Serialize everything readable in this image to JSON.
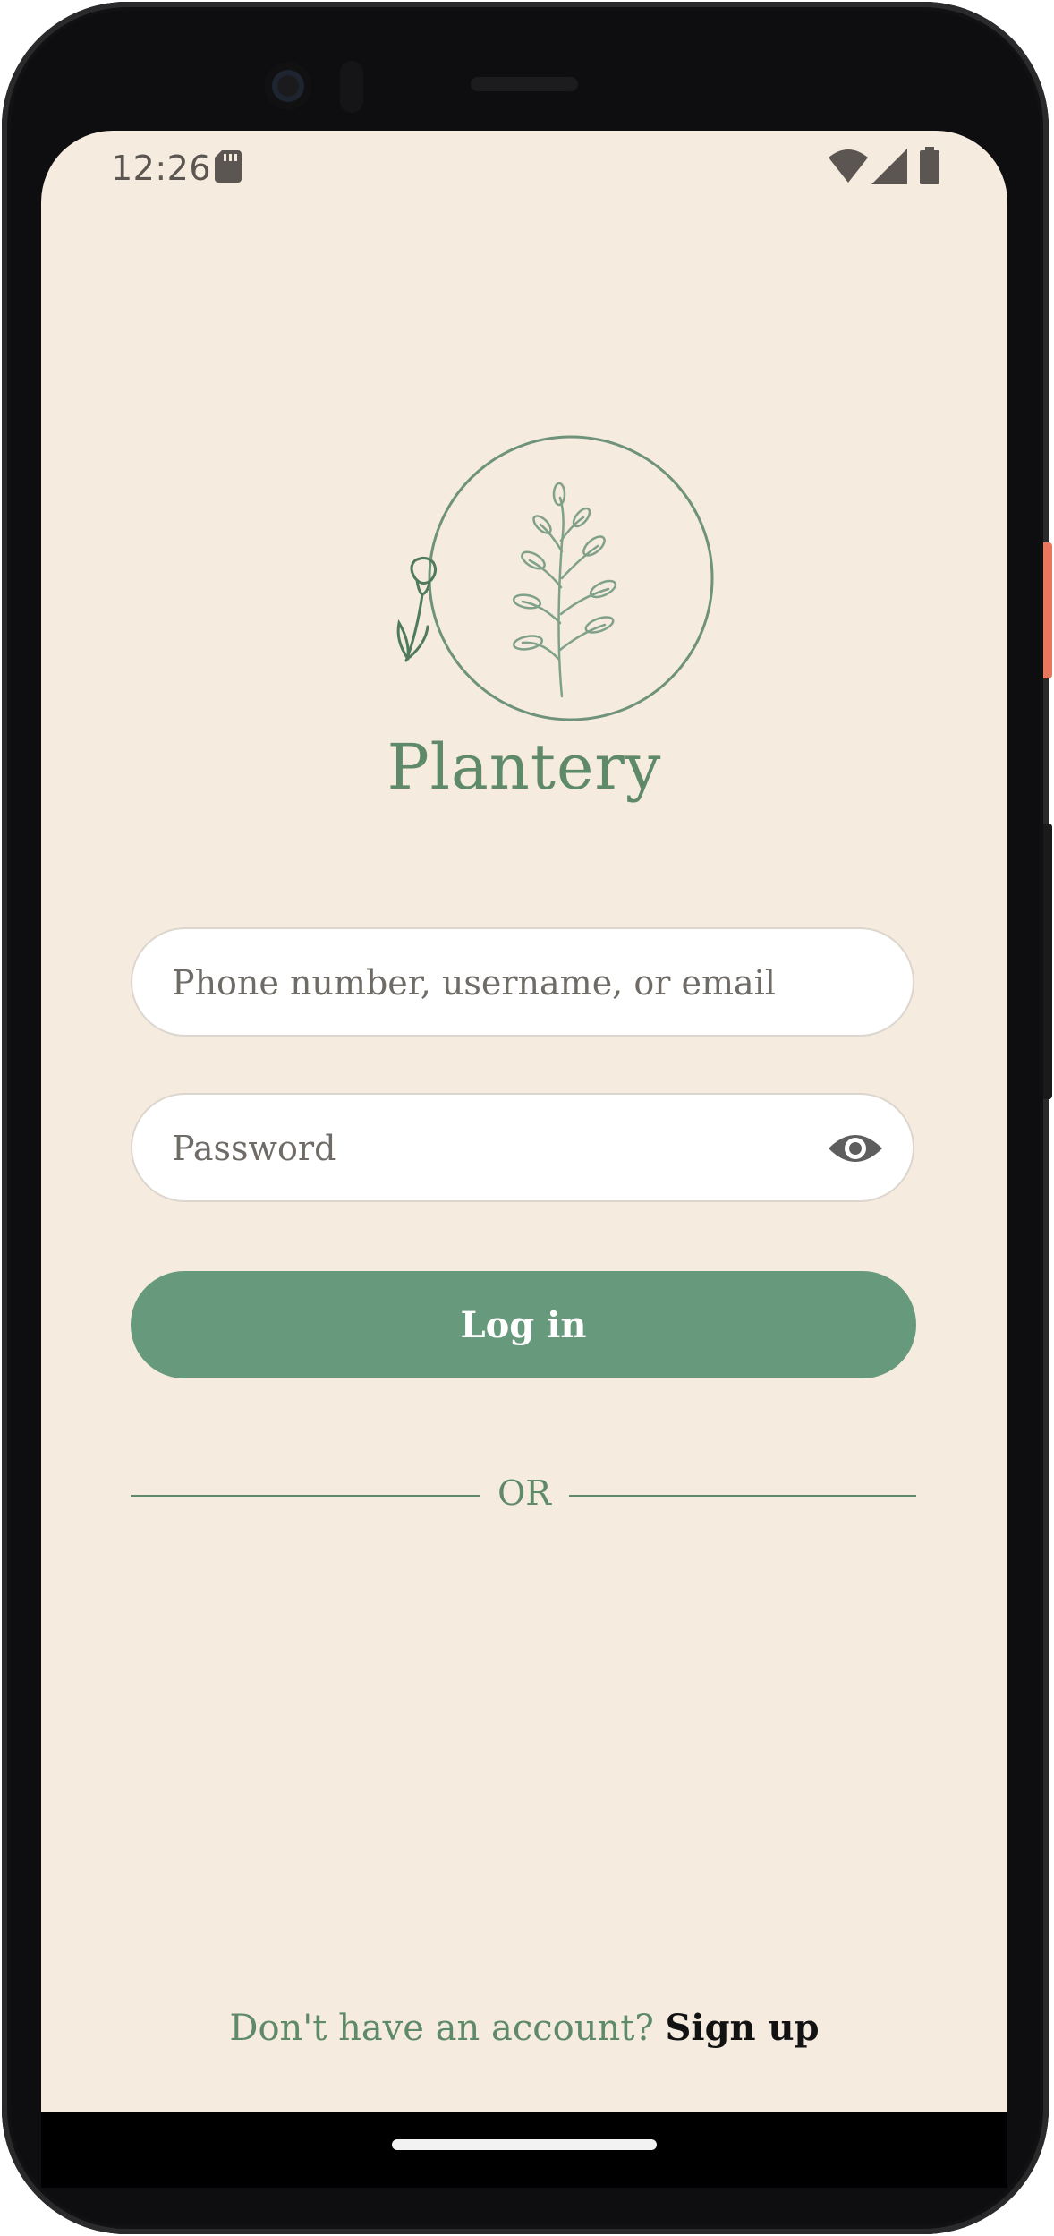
{
  "status_bar": {
    "time": "12:26",
    "icons": [
      "sd-card-icon",
      "wifi-icon",
      "cell-signal-icon",
      "battery-icon"
    ]
  },
  "app": {
    "name": "Plantery",
    "logo": "plant-circle-logo"
  },
  "login_form": {
    "username_placeholder": "Phone number, username, or email",
    "username_value": "",
    "password_placeholder": "Password",
    "password_value": "",
    "password_toggle_icon": "eye-icon",
    "login_label": "Log in",
    "divider_label": "OR"
  },
  "footer": {
    "prompt": "Don't have an account?",
    "signup_label": "Sign up"
  },
  "colors": {
    "background": "#f6ebdf",
    "accent": "#5f8a6a",
    "button": "#679a7c"
  }
}
